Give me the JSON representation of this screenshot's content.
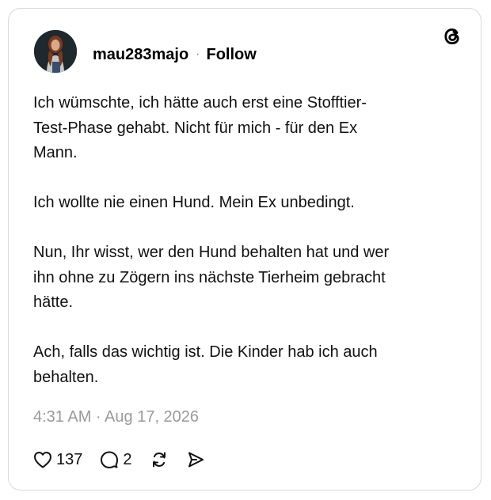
{
  "post": {
    "username": "mau283majo",
    "separator": "·",
    "follow_label": "Follow",
    "paragraphs": [
      "Ich wümschte, ich hätte auch erst eine Stofftier-\nTest-Phase gehabt. Nicht für mich - für den Ex\nMann.",
      "Ich wollte nie einen Hund. Mein Ex unbedingt.",
      "Nun, Ihr wisst, wer den Hund behalten hat und wer\nihn ohne zu Zögern ins nächste Tierheim gebracht\nhätte.",
      "Ach, falls das wichtig ist. Die Kinder hab ich auch\nbehalten."
    ],
    "timestamp": "4:31 AM · Aug 17, 2026",
    "like_count": "137",
    "reply_count": "2"
  },
  "icons": {
    "brand": "threads-logo-icon",
    "like": "heart-icon",
    "reply": "speech-bubble-icon",
    "repost": "repost-icon",
    "share": "send-icon"
  },
  "colors": {
    "card_border": "#d9d9d9",
    "text": "#111111",
    "muted": "#9a9a9a"
  }
}
